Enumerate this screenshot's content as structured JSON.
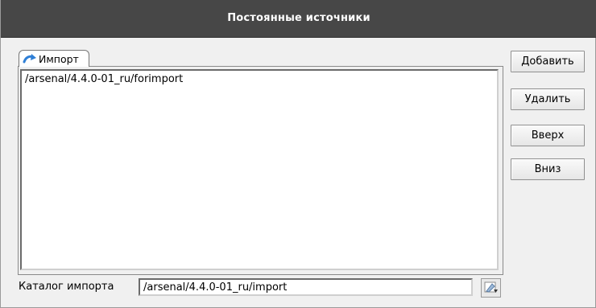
{
  "window": {
    "title": "Постоянные источники"
  },
  "tab": {
    "label": "Импорт",
    "icon": "import-arrow-icon"
  },
  "sources": [
    "/arsenal/4.4.0-01_ru/forimport"
  ],
  "buttons": {
    "add": "Добавить",
    "delete": "Удалить",
    "up": "Вверх",
    "down": "Вниз"
  },
  "import_dir": {
    "label": "Каталог импорта",
    "value": "/arsenal/4.4.0-01_ru/import",
    "browse_icon": "folder-browse-icon"
  },
  "colors": {
    "titlebar": "#474747",
    "background": "#f0f0f0",
    "icon_accent": "#2f7fd6"
  }
}
